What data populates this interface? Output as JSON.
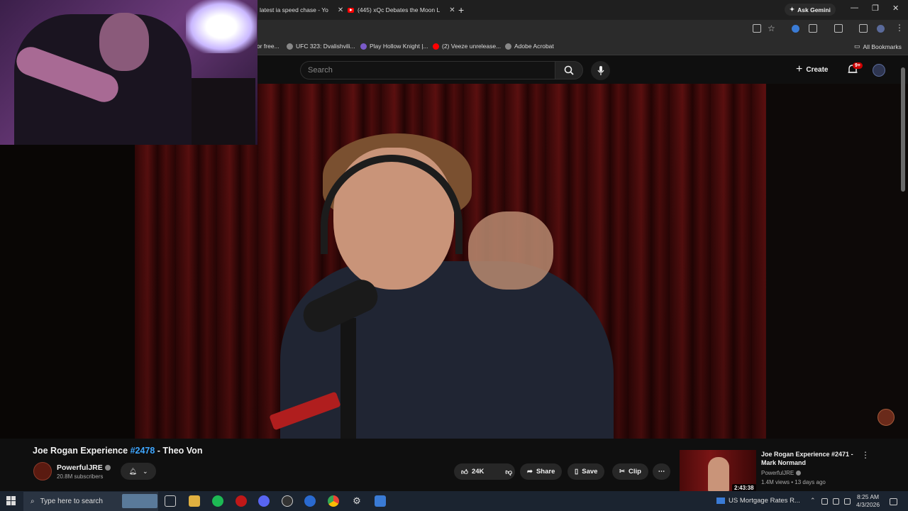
{
  "browser": {
    "tabs": [
      {
        "label": "latest ia speed chase - Yo"
      },
      {
        "label": "(445) xQc Debates the Moon L"
      }
    ],
    "ask_gemini": "Ask Gemini",
    "bookmarks": [
      {
        "label": "or free..."
      },
      {
        "label": "UFC 323: Dvalishvili..."
      },
      {
        "label": "Play Hollow Knight |..."
      },
      {
        "label": "(2) Veeze unrelease..."
      },
      {
        "label": "Adobe Acrobat"
      }
    ],
    "all_bookmarks": "All Bookmarks"
  },
  "youtube": {
    "search_placeholder": "Search",
    "create_label": "Create",
    "notif_count": "9+",
    "video": {
      "title_prefix": "Joe Rogan Experience ",
      "title_tag": "#2478",
      "title_suffix": " - Theo Von",
      "channel": "PowerfulJRE",
      "subscribers": "20.8M subscribers",
      "likes": "24K",
      "share": "Share",
      "save": "Save",
      "clip": "Clip"
    },
    "recommended": {
      "title": "Joe Rogan Experience #2471 - Mark Normand",
      "channel": "PowerfulJRE",
      "meta": "1.4M views • 13 days ago",
      "duration": "2:43:38"
    }
  },
  "taskbar": {
    "search_placeholder": "Type here to search",
    "news": "US Mortgage Rates R...",
    "time": "8:25 AM",
    "date": "4/3/2026"
  },
  "colors": {
    "accent_link": "#3ea6ff",
    "yt_red": "#ff0000",
    "badge_red": "#cc0000"
  }
}
